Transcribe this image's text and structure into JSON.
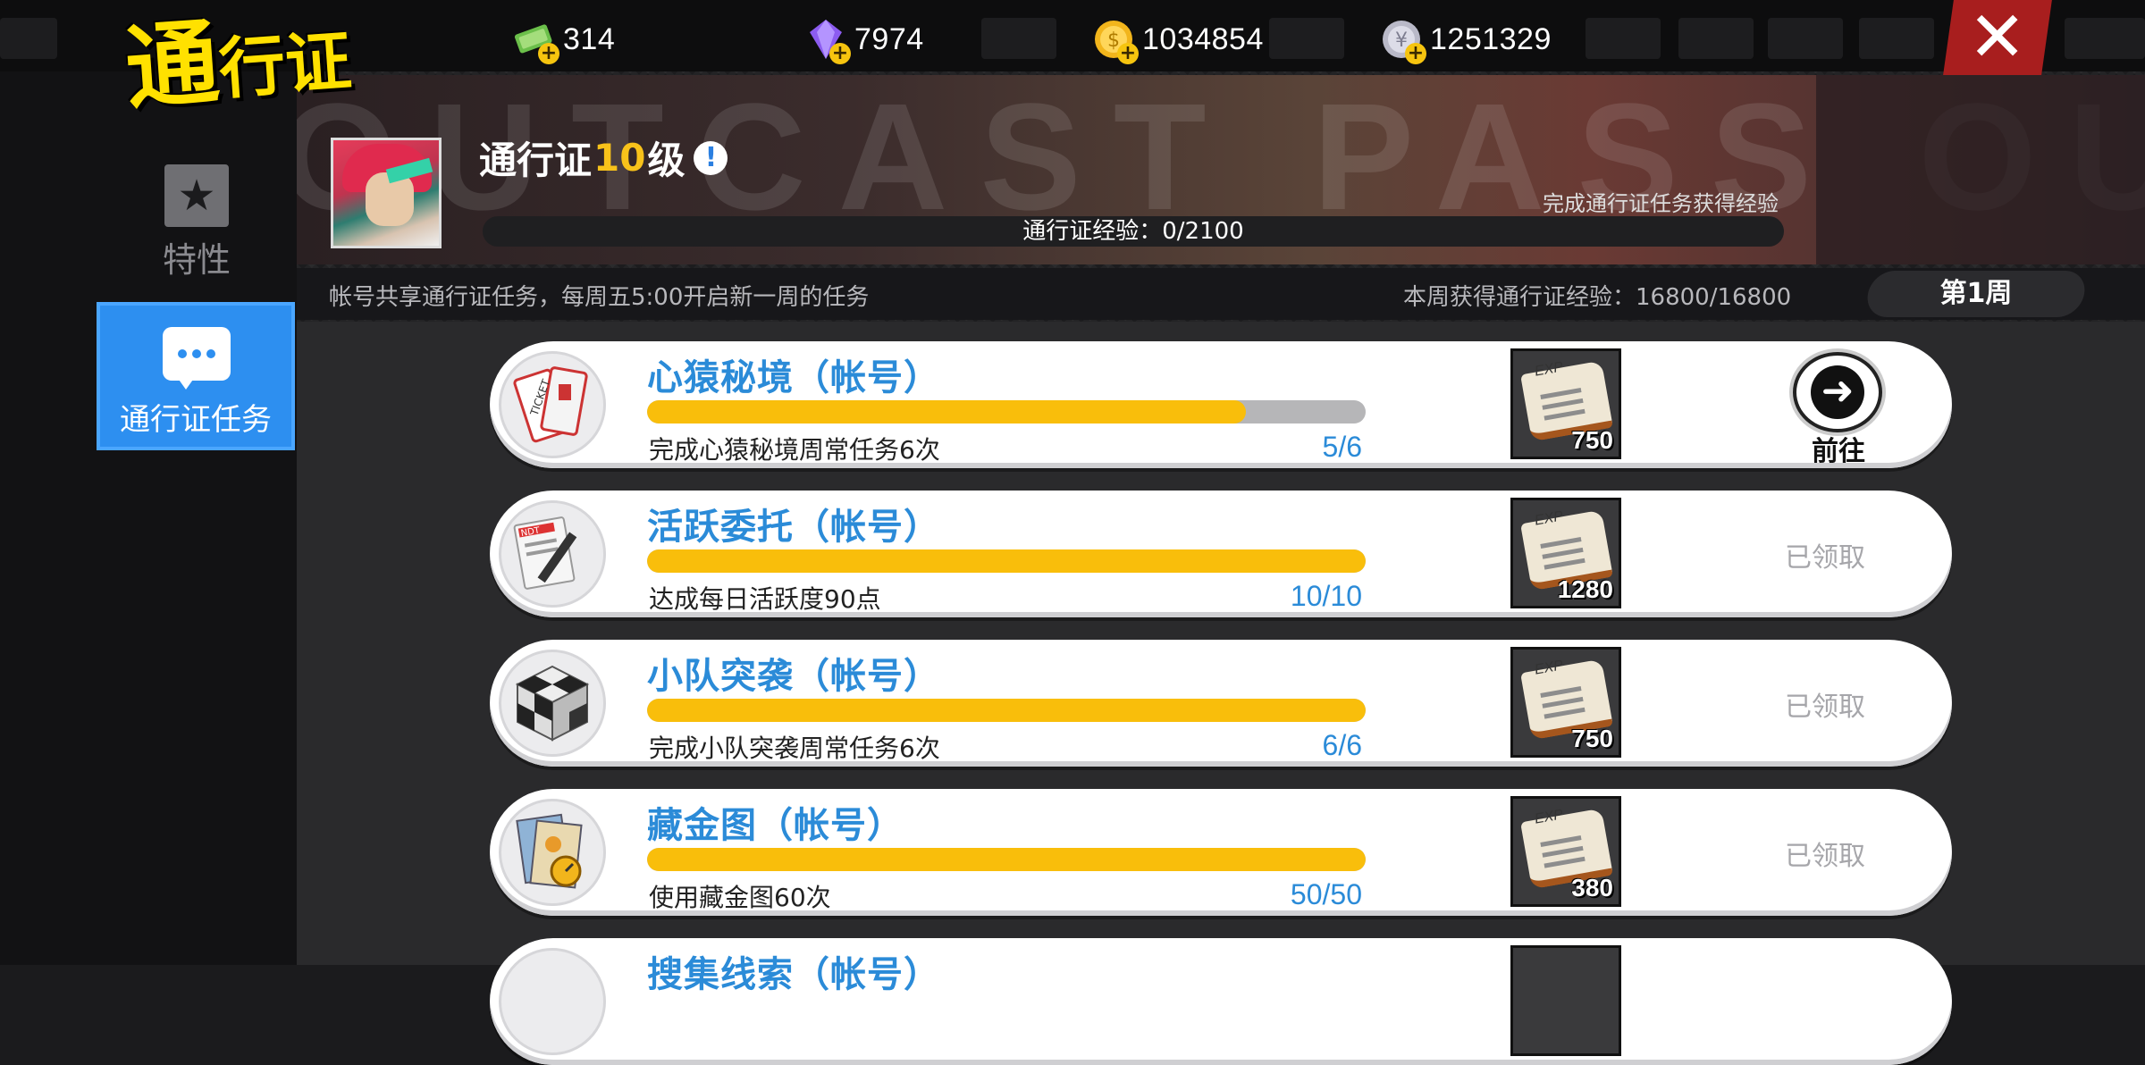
{
  "currencies": [
    {
      "name": "cash",
      "value": "314",
      "color": "#6bbf4a",
      "icon": "cash-icon"
    },
    {
      "name": "crystal",
      "value": "7974",
      "color": "#8c5cf0",
      "icon": "crystal-icon"
    },
    {
      "name": "gold-coin",
      "value": "1034854",
      "color": "#f2b51c",
      "icon": "gold-coin-icon"
    },
    {
      "name": "silver-coin",
      "value": "1251329",
      "color": "#b9b9c8",
      "icon": "silver-coin-icon"
    }
  ],
  "logo": {
    "first_char": "通",
    "rest": "行证"
  },
  "close": {
    "icon": "close-icon",
    "glyph": "✕"
  },
  "sidebar": {
    "items": [
      {
        "label": "特性",
        "icon": "star-icon",
        "active": false
      },
      {
        "label": "通行证任务",
        "icon": "chat-bubble-icon",
        "active": true
      }
    ]
  },
  "banner": {
    "background_text": "OUTCAST PASS OUT",
    "title_prefix": "通行证 ",
    "level": "10",
    "title_suffix": "级",
    "info_glyph": "!",
    "exp_hint": "完成通行证任务获得经验",
    "exp_text": "通行证经验：0/2100",
    "exp_current": 0,
    "exp_max": 2100
  },
  "info_strip": {
    "left_text": "帐号共享通行证任务，每周五5:00开启新一周的任务",
    "right_text": "本周获得通行证经验：16800/16800",
    "week_label": "第1周"
  },
  "tasks": [
    {
      "title": "心猿秘境（帐号）",
      "description": "完成心猿秘境周常任务6次",
      "count": "5/6",
      "progress": 0.833,
      "reward_qty": "750",
      "reward_icon": "exp-book-icon",
      "status": "go",
      "go_label": "前往",
      "task_icon": "ticket-icon"
    },
    {
      "title": "活跃委托（帐号）",
      "description": "达成每日活跃度90点",
      "count": "10/10",
      "progress": 1.0,
      "reward_qty": "1280",
      "reward_icon": "exp-book-icon",
      "status": "claimed",
      "claimed_label": "已领取",
      "task_icon": "newspaper-pen-icon"
    },
    {
      "title": "小队突袭（帐号）",
      "description": "完成小队突袭周常任务6次",
      "count": "6/6",
      "progress": 1.0,
      "reward_qty": "750",
      "reward_icon": "exp-book-icon",
      "status": "claimed",
      "claimed_label": "已领取",
      "task_icon": "cube-icon"
    },
    {
      "title": "藏金图（帐号）",
      "description": "使用藏金图60次",
      "count": "50/50",
      "progress": 1.0,
      "reward_qty": "380",
      "reward_icon": "exp-book-icon",
      "status": "claimed",
      "claimed_label": "已领取",
      "task_icon": "treasure-map-icon"
    },
    {
      "title": "搜集线索（帐号）",
      "description": "",
      "count": "",
      "progress": 0,
      "reward_qty": "",
      "reward_icon": "exp-book-icon",
      "status": "partial",
      "task_icon": "clue-icon"
    }
  ],
  "reward_exp_label": "EXP",
  "colors": {
    "accent_blue": "#2b8bd8",
    "progress_yellow": "#f9be0b",
    "level_yellow": "#f8c21a",
    "logo_yellow": "#ffe100",
    "close_red": "#a81e1e"
  }
}
